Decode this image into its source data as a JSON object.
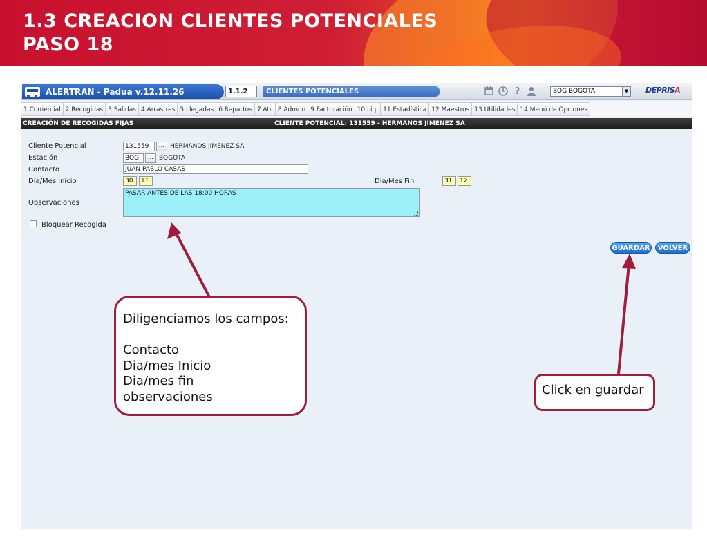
{
  "slide": {
    "title_line1": "1.3 CREACION CLIENTES POTENCIALES",
    "title_line2": "PASO 18"
  },
  "app": {
    "name": "ALERTRAN - Padua  v.12.11.26",
    "module_code": "1.1.2",
    "module_name": "CLIENTES POTENCIALES",
    "station_selected": "BOG BOGOTA",
    "logo_main": "DEPRIS",
    "logo_accent": "A",
    "icons": [
      "calendar-icon",
      "clock-icon",
      "help-icon",
      "user-icon"
    ]
  },
  "menu": {
    "tabs": [
      "1.Comercial",
      "2.Recogidas",
      "3.Salidas",
      "4.Arrastres",
      "5.Llegadas",
      "6.Repartos",
      "7.Atc",
      "8.Admon",
      "9.Facturación",
      "10.Liq.",
      "11.Estadística",
      "12.Maestros",
      "13.Utilidades",
      "14.Menú de Opciones"
    ]
  },
  "section": {
    "left_title": "CREACIÓN DE RECOGIDAS FIJAS",
    "right_title": "CLIENTE POTENCIAL: 131559 - HERMANOS JIMENEZ SA"
  },
  "form": {
    "cliente_label": "Cliente Potencial",
    "cliente_code": "131559",
    "cliente_name": "HERMANOS JIMENEZ SA",
    "estacion_label": "Estación",
    "estacion_code": "BOG",
    "estacion_name": "BOGOTA",
    "contacto_label": "Contacto",
    "contacto_value": "JUAN PABLO CASAS",
    "inicio_label": "Día/Mes Inicio",
    "inicio_dia": "30",
    "inicio_mes": "11",
    "fin_label": "Día/Mes Fin",
    "fin_dia": "31",
    "fin_mes": "12",
    "observaciones_label": "Observaciones",
    "observaciones_value": "PASAR ANTES DE LAS 18:00 HORAS",
    "bloquear_label": "Bloquear Recogida",
    "dots_label": "...",
    "guardar_label": "GUARDAR",
    "volver_label": "VOLVER"
  },
  "callouts": {
    "left_lines": [
      "Diligenciamos los campos:",
      "",
      "Contacto",
      "Dia/mes Inicio",
      "Dia/mes fin",
      "observaciones"
    ],
    "right_text": "Click en guardar"
  },
  "colors": {
    "header_red": "#c8102e",
    "callout_border": "#a01e3c",
    "app_blue": "#1c4fa6",
    "field_yellow": "#ffffb0",
    "field_cyan": "#9ef0f8"
  }
}
